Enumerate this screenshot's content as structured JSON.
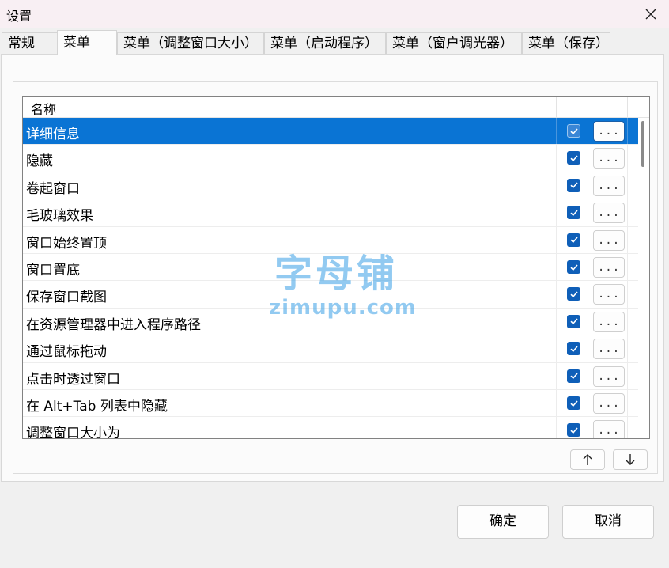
{
  "window": {
    "title": "设置"
  },
  "tabs": [
    {
      "label": "常规"
    },
    {
      "label": "菜单"
    },
    {
      "label": "菜单（调整窗口大小）"
    },
    {
      "label": "菜单（启动程序）"
    },
    {
      "label": "菜单（窗户调光器）"
    },
    {
      "label": "菜单（保存）"
    }
  ],
  "active_tab": "菜单",
  "list": {
    "header": {
      "name": "名称"
    },
    "rows": [
      {
        "name": "详细信息",
        "checked": true,
        "button": "..."
      },
      {
        "name": "隐藏",
        "checked": true,
        "button": "..."
      },
      {
        "name": "卷起窗口",
        "checked": true,
        "button": "..."
      },
      {
        "name": "毛玻璃效果",
        "checked": true,
        "button": "..."
      },
      {
        "name": "窗口始终置顶",
        "checked": true,
        "button": "..."
      },
      {
        "name": "窗口置底",
        "checked": true,
        "button": "..."
      },
      {
        "name": "保存窗口截图",
        "checked": true,
        "button": "..."
      },
      {
        "name": "在资源管理器中进入程序路径",
        "checked": true,
        "button": "..."
      },
      {
        "name": "通过鼠标拖动",
        "checked": true,
        "button": "..."
      },
      {
        "name": "点击时透过窗口",
        "checked": true,
        "button": "..."
      },
      {
        "name": "在 Alt+Tab 列表中隐藏",
        "checked": true,
        "button": "..."
      },
      {
        "name": "调整窗口大小为",
        "checked": true,
        "button": "..."
      }
    ],
    "selected_index": 0
  },
  "buttons": {
    "ok": "确定",
    "cancel": "取消"
  },
  "watermark": {
    "cn": "字母铺",
    "en": "zimupu.com"
  },
  "colors": {
    "accent": "#0a74d4",
    "checkbox": "#0f5fb8",
    "title_bg": "#f8eff3"
  },
  "icons": {
    "close": "close-icon",
    "up": "arrow-up-icon",
    "down": "arrow-down-icon",
    "check": "checkmark-icon"
  }
}
